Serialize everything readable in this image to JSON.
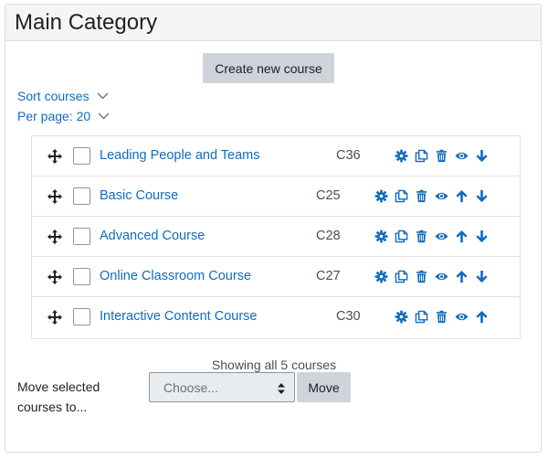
{
  "header": {
    "title": "Main Category"
  },
  "toolbar": {
    "create_label": "Create new course"
  },
  "sort": {
    "label": "Sort courses"
  },
  "perpage": {
    "label": "Per page: 20"
  },
  "courses": [
    {
      "name": "Leading People and Teams",
      "id": "C36",
      "actions": [
        "gear-icon",
        "copy-icon",
        "trash-icon",
        "eye-icon",
        "arrow-down-icon"
      ]
    },
    {
      "name": "Basic Course",
      "id": "C25",
      "actions": [
        "gear-icon",
        "copy-icon",
        "trash-icon",
        "eye-icon",
        "arrow-up-icon",
        "arrow-down-icon"
      ]
    },
    {
      "name": "Advanced Course",
      "id": "C28",
      "actions": [
        "gear-icon",
        "copy-icon",
        "trash-icon",
        "eye-icon",
        "arrow-up-icon",
        "arrow-down-icon"
      ]
    },
    {
      "name": "Online Classroom Course",
      "id": "C27",
      "actions": [
        "gear-icon",
        "copy-icon",
        "trash-icon",
        "eye-icon",
        "arrow-up-icon",
        "arrow-down-icon"
      ]
    },
    {
      "name": "Interactive Content Course",
      "id": "C30",
      "actions": [
        "gear-icon",
        "copy-icon",
        "trash-icon",
        "eye-icon",
        "arrow-up-icon"
      ]
    }
  ],
  "footer": {
    "showing": "Showing all 5 courses",
    "move_label": "Move selected courses to...",
    "select_placeholder": "Choose...",
    "move_button": "Move"
  },
  "colors": {
    "link": "#0f6cbf",
    "button": "#ced4da",
    "border": "#dee2e6"
  }
}
